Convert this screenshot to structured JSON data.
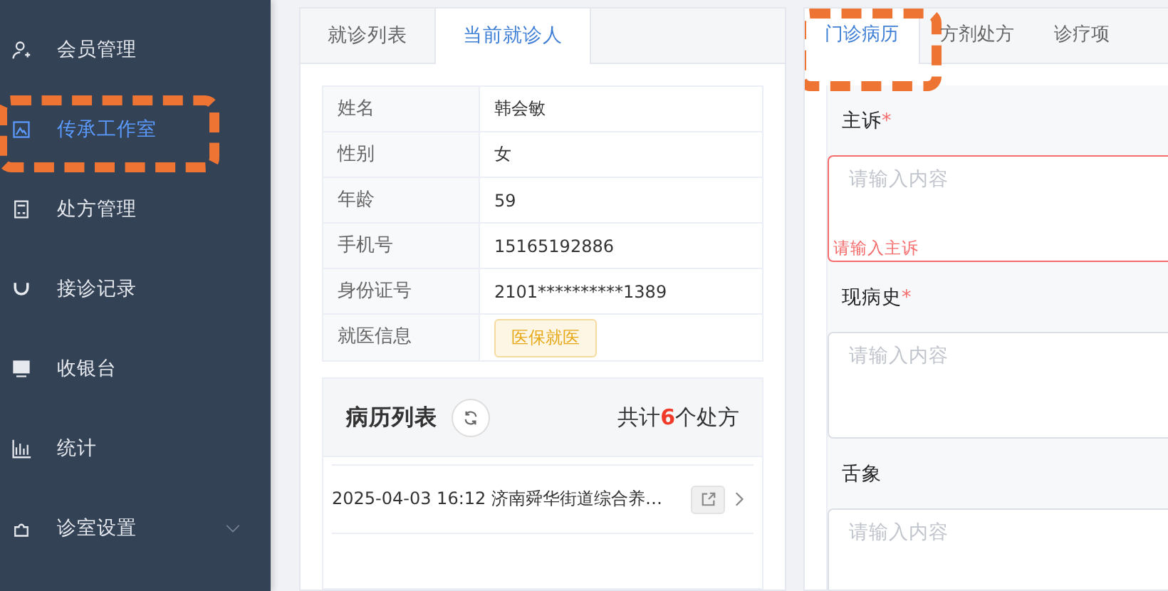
{
  "sidebar": {
    "items": [
      {
        "label": "会员管理",
        "selected": false,
        "highlighted": false,
        "expandable": false
      },
      {
        "label": "传承工作室",
        "selected": true,
        "highlighted": true,
        "expandable": false
      },
      {
        "label": "处方管理",
        "selected": false,
        "highlighted": false,
        "expandable": false
      },
      {
        "label": "接诊记录",
        "selected": false,
        "highlighted": false,
        "expandable": false
      },
      {
        "label": "收银台",
        "selected": false,
        "highlighted": false,
        "expandable": false
      },
      {
        "label": "统计",
        "selected": false,
        "highlighted": false,
        "expandable": false
      },
      {
        "label": "诊室设置",
        "selected": false,
        "highlighted": false,
        "expandable": true
      }
    ]
  },
  "patient_panel": {
    "tabs": [
      {
        "label": "就诊列表",
        "selected": false
      },
      {
        "label": "当前就诊人",
        "selected": true
      }
    ],
    "info": [
      {
        "label": "姓名",
        "value": "韩会敏"
      },
      {
        "label": "性别",
        "value": "女"
      },
      {
        "label": "年龄",
        "value": "59"
      },
      {
        "label": "手机号",
        "value": "15165192886"
      },
      {
        "label": "身份证号",
        "value": "2101**********1389"
      },
      {
        "label": "就医信息",
        "tag": "医保就医"
      }
    ],
    "records": {
      "title": "病历列表",
      "total_prefix": "共计",
      "total_count": "6",
      "total_suffix": "个处方",
      "rows": [
        {
          "text": "2025-04-03 16:12 济南舜华街道综合养…"
        }
      ]
    }
  },
  "record_panel": {
    "tabs": [
      {
        "label": "门诊病历",
        "selected": true,
        "highlighted": true
      },
      {
        "label": "方剂处方",
        "selected": false,
        "highlighted": false
      },
      {
        "label": "诊疗项",
        "selected": false,
        "highlighted": false
      }
    ],
    "fields": [
      {
        "label": "主诉",
        "required_mark": "*",
        "placeholder": "请输入内容",
        "error": "请输入主诉"
      },
      {
        "label": "现病史",
        "required_mark": "*",
        "placeholder": "请输入内容"
      },
      {
        "label": "舌象",
        "placeholder": "请输入内容"
      }
    ]
  }
}
